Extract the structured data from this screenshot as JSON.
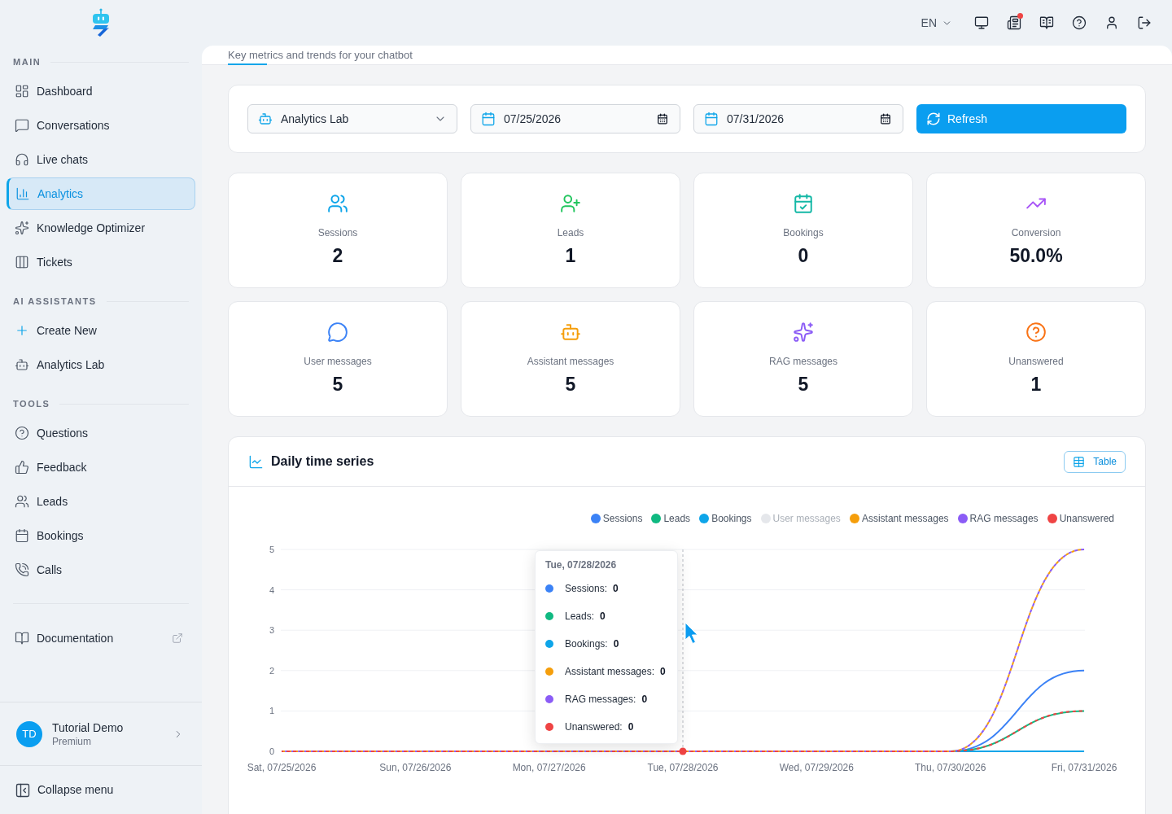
{
  "sidebar": {
    "sections": [
      {
        "title": "MAIN",
        "items": [
          {
            "label": "Dashboard",
            "selected": false
          },
          {
            "label": "Conversations",
            "selected": false
          },
          {
            "label": "Live chats",
            "selected": false
          },
          {
            "label": "Analytics",
            "selected": true
          },
          {
            "label": "Knowledge Optimizer",
            "selected": false
          },
          {
            "label": "Tickets",
            "selected": false
          }
        ]
      },
      {
        "title": "AI ASSISTANTS",
        "items": [
          {
            "label": "Create New",
            "selected": false
          },
          {
            "label": "Analytics Lab",
            "selected": false
          }
        ]
      },
      {
        "title": "TOOLS",
        "items": [
          {
            "label": "Questions",
            "selected": false
          },
          {
            "label": "Feedback",
            "selected": false
          },
          {
            "label": "Leads",
            "selected": false
          },
          {
            "label": "Bookings",
            "selected": false
          },
          {
            "label": "Calls",
            "selected": false
          }
        ]
      }
    ],
    "documentation": "Documentation",
    "user": {
      "initials": "TD",
      "name": "Tutorial Demo",
      "plan": "Premium"
    },
    "collapse": "Collapse menu"
  },
  "topbar": {
    "language": "EN",
    "news_unread": true
  },
  "header": {
    "subtitle": "Key metrics and trends for your chatbot"
  },
  "filters": {
    "assistant": "Analytics Lab",
    "start_date": "07/25/2026",
    "end_date": "07/31/2026",
    "refresh": "Refresh"
  },
  "stats": [
    {
      "label": "Sessions",
      "value": "2"
    },
    {
      "label": "Leads",
      "value": "1"
    },
    {
      "label": "Bookings",
      "value": "0"
    },
    {
      "label": "Conversion",
      "value": "50.0%"
    },
    {
      "label": "User messages",
      "value": "5"
    },
    {
      "label": "Assistant messages",
      "value": "5"
    },
    {
      "label": "RAG messages",
      "value": "5"
    },
    {
      "label": "Unanswered",
      "value": "1"
    }
  ],
  "timeseries": {
    "title": "Daily time series",
    "view_button": "Table",
    "chart_data": {
      "type": "line",
      "legend": "upper right",
      "categories": [
        "Sat, 07/25/2026",
        "Sun, 07/26/2026",
        "Mon, 07/27/2026",
        "Tue, 07/28/2026",
        "Wed, 07/29/2026",
        "Thu, 07/30/2026",
        "Fri, 07/31/2026"
      ],
      "ylim": [
        0,
        5
      ],
      "yticks": [
        0,
        1,
        2,
        3,
        4,
        5
      ],
      "series": [
        {
          "name": "Sessions",
          "color": "#3b82f6",
          "line_style": "solid",
          "values": [
            null,
            null,
            null,
            null,
            null,
            0,
            2
          ]
        },
        {
          "name": "Leads",
          "color": "#10b981",
          "line_style": "solid",
          "values": [
            null,
            null,
            null,
            null,
            null,
            0,
            1
          ]
        },
        {
          "name": "Bookings",
          "color": "#0ea5e9",
          "line_style": "solid",
          "values": [
            null,
            null,
            null,
            null,
            null,
            0,
            0
          ]
        },
        {
          "name": "User messages",
          "color": "#e5e7eb",
          "values": [
            null,
            null,
            null,
            null,
            null,
            null,
            null
          ]
        },
        {
          "name": "Assistant messages",
          "color": "#f59e0b",
          "line_style": "dashed",
          "values": [
            0,
            0,
            0,
            0,
            0,
            0,
            5
          ]
        },
        {
          "name": "RAG messages",
          "color": "#8b5cf6",
          "line_style": "dashed",
          "values": [
            0,
            0,
            0,
            0,
            0,
            0,
            5
          ]
        },
        {
          "name": "Unanswered",
          "color": "#ef4444",
          "line_style": "dashed",
          "values": [
            0,
            0,
            0,
            0,
            0,
            0,
            1
          ]
        }
      ]
    },
    "series_hidden": [
      false,
      false,
      false,
      true,
      false,
      false,
      false
    ],
    "x_hover": [
      false,
      false,
      false,
      true,
      false,
      false,
      false
    ],
    "tooltip": {
      "title": "Tue, 07/28/2026",
      "rows": [
        {
          "label": "Sessions:",
          "value": "0",
          "color": "#3b82f6"
        },
        {
          "label": "Leads:",
          "value": "0",
          "color": "#10b981"
        },
        {
          "label": "Bookings:",
          "value": "0",
          "color": "#0ea5e9"
        },
        {
          "label": "Assistant messages:",
          "value": "0",
          "color": "#f59e0b"
        },
        {
          "label": "RAG messages:",
          "value": "0",
          "color": "#8b5cf6"
        },
        {
          "label": "Unanswered:",
          "value": "0",
          "color": "#ef4444"
        }
      ]
    }
  }
}
